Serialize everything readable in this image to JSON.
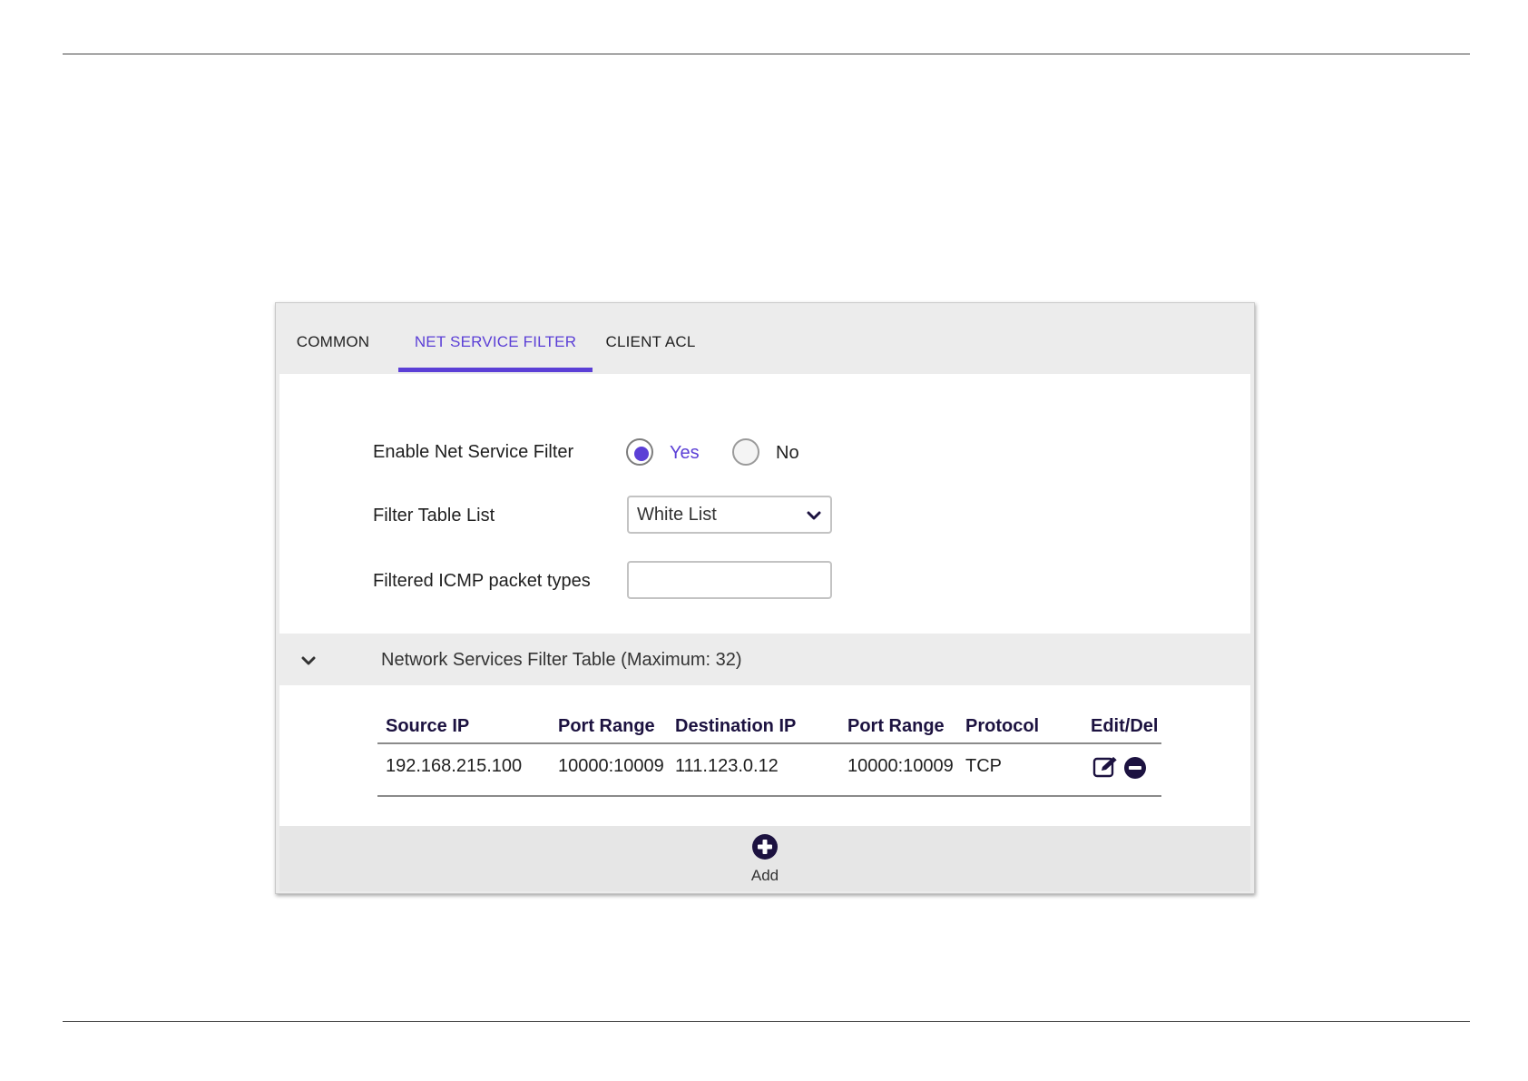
{
  "tabs": [
    {
      "label": "COMMON",
      "active": false
    },
    {
      "label": "NET SERVICE FILTER",
      "active": true
    },
    {
      "label": "CLIENT ACL",
      "active": false
    }
  ],
  "colors": {
    "accent": "#5b3fd6",
    "header_text": "#1c1240",
    "panel_bg": "#ececec"
  },
  "form": {
    "enable_label": "Enable Net Service Filter",
    "enable_options": {
      "yes": "Yes",
      "no": "No"
    },
    "enable_selected": "Yes",
    "filter_table_label": "Filter Table List",
    "filter_table_value": "White List",
    "icmp_label": "Filtered ICMP packet types",
    "icmp_value": ""
  },
  "section": {
    "title": "Network Services Filter Table (Maximum: 32)",
    "toggle_icon": "chevron-down-icon"
  },
  "table": {
    "columns": [
      "Source IP",
      "Port Range",
      "Destination IP",
      "Port Range",
      "Protocol",
      "Edit/Del"
    ],
    "rows": [
      {
        "source_ip": "192.168.215.100",
        "source_port_range": "10000:10009",
        "destination_ip": "111.123.0.12",
        "destination_port_range": "10000:10009",
        "protocol": "TCP",
        "actions": [
          "edit-icon",
          "delete-icon"
        ]
      }
    ]
  },
  "add": {
    "label": "Add",
    "icon": "plus-circle-icon"
  }
}
